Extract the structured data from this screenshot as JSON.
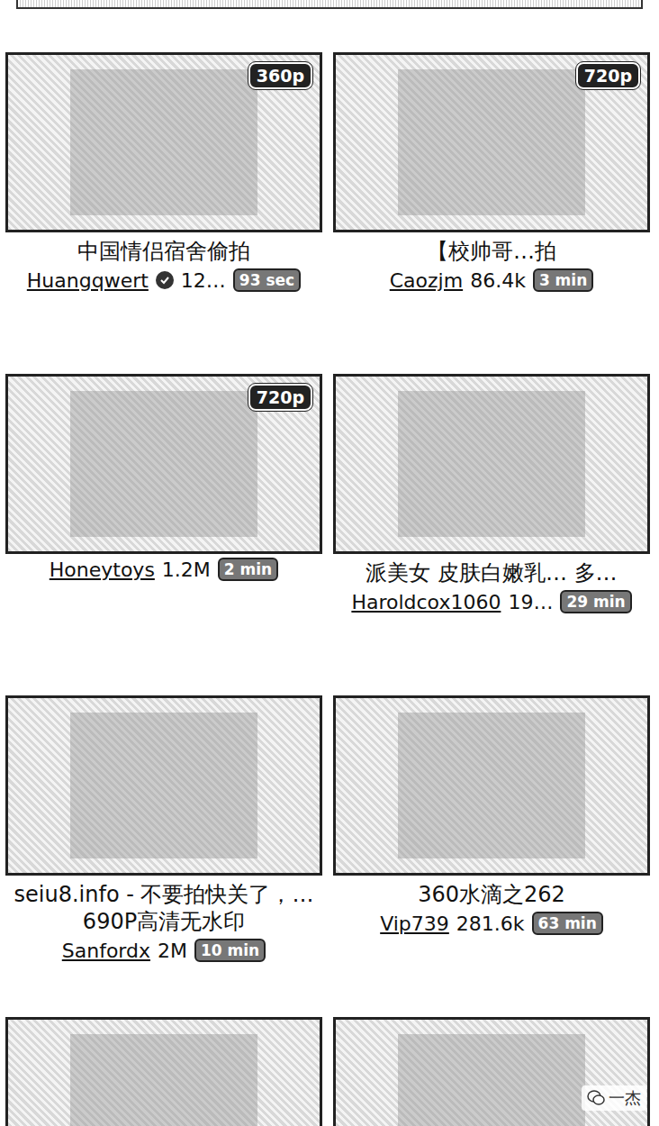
{
  "cards": [
    {
      "kind": "full",
      "quality": "360p",
      "title": "中国情侣宿舍偷拍",
      "user": "Huangqwert",
      "verified": true,
      "views": "12…",
      "duration": "93 sec"
    },
    {
      "kind": "full",
      "quality": "720p",
      "title": "【校帅哥…拍",
      "user": "Caozjm",
      "verified": false,
      "views": "86.4k",
      "duration": "3 min"
    },
    {
      "kind": "full",
      "quality": "720p",
      "title": "",
      "user": "Honeytoys",
      "verified": false,
      "views": "1.2M",
      "duration": "2 min"
    },
    {
      "kind": "full",
      "quality": "",
      "title": "派美女 皮肤白嫩乳… 多…",
      "user": "Haroldcox1060",
      "verified": false,
      "views": "19…",
      "duration": "29 min"
    },
    {
      "kind": "full",
      "quality": "",
      "title": "seiu8.info - 不要拍快关了，… 690P高清无水印",
      "user": "Sanfordx",
      "verified": false,
      "views": "2M",
      "duration": "10 min"
    },
    {
      "kind": "full",
      "quality": "",
      "title": "360水滴之262",
      "user": "Vip739",
      "verified": false,
      "views": "281.6k",
      "duration": "63 min"
    },
    {
      "kind": "thumb-only",
      "quality": "",
      "title": "",
      "user": "",
      "verified": false,
      "views": "",
      "duration": ""
    },
    {
      "kind": "thumb-only",
      "quality": "",
      "title": "",
      "user": "",
      "verified": false,
      "views": "",
      "duration": ""
    }
  ],
  "watermark": "一杰"
}
